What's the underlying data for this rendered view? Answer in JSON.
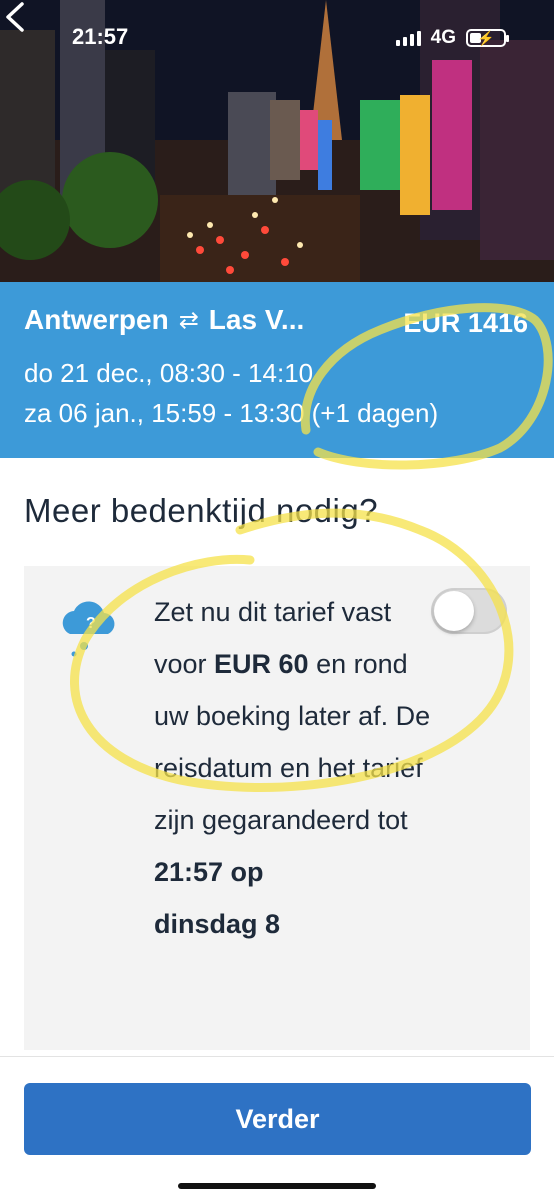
{
  "status_bar": {
    "time": "21:57",
    "network": "4G",
    "battery_level": 0.3
  },
  "hero": {
    "description_icon": "city-night-photo"
  },
  "trip": {
    "route_from": "Antwerpen",
    "route_to": "Las V...",
    "price": "EUR 1416",
    "outbound": "do 21 dec., 08:30 - 14:10",
    "return": "za 06 jan., 15:59 - 13:30 (+1 dagen)"
  },
  "hold": {
    "heading": "Meer bedenktijd nodig?",
    "text_1": "Zet nu dit tarief vast voor ",
    "amount": "EUR 60",
    "text_2": " en rond uw boeking later af. De reisdatum en het tarief zijn gegarandeerd tot ",
    "deadline_time": "21:57 op",
    "deadline_day": "dinsdag 8",
    "toggle_on": false
  },
  "footer": {
    "continue_label": "Verder"
  },
  "colors": {
    "header_blue": "#3d9ad8",
    "button_blue": "#2e72c4",
    "highlight": "#f5e24a"
  }
}
